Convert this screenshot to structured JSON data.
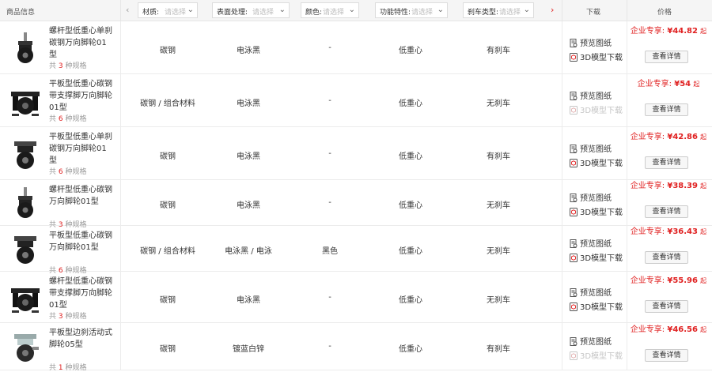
{
  "header": {
    "product_col": "商品信息",
    "prev_icon": "chevron-left-icon",
    "next_icon": "chevron-right-icon",
    "filters": [
      {
        "label": "材质:",
        "placeholder": "请选择"
      },
      {
        "label": "表面处理:",
        "placeholder": "请选择"
      },
      {
        "label": "颜色:",
        "placeholder": "请选择"
      },
      {
        "label": "功能特性:",
        "placeholder": "请选择"
      },
      {
        "label": "刹车类型:",
        "placeholder": "请选择"
      }
    ],
    "download_col": "下载",
    "price_col": "价格"
  },
  "labels": {
    "count_prefix": "共",
    "count_suffix": "种规格",
    "preview": "预览图纸",
    "model3d": "3D模型下载",
    "price_prefix": "企业专享:",
    "currency": "¥",
    "price_unit": "起",
    "detail_button": "查看详情"
  },
  "colors": {
    "accent": "#e02020",
    "disabled": "#c6c6c6"
  },
  "products": [
    {
      "name": "螺杆型低重心单刹碳钢万向脚轮01型",
      "count": "3",
      "image": "threaded-stem-caster",
      "material": "碳钢",
      "surface": "电泳黑",
      "color": "-",
      "feature": "低重心",
      "brake": "有刹车",
      "model_available": true,
      "price": "44.82"
    },
    {
      "name": "平板型低重心碳钢带支撑脚万向脚轮01型",
      "count": "6",
      "image": "plate-leveling-caster",
      "material": "碳钢 / 组合材料",
      "surface": "电泳黑",
      "color": "-",
      "feature": "低重心",
      "brake": "无刹车",
      "model_available": false,
      "price": "54"
    },
    {
      "name": "平板型低重心单刹碳钢万向脚轮01型",
      "count": "6",
      "image": "plate-brake-caster",
      "material": "碳钢",
      "surface": "电泳黑",
      "color": "-",
      "feature": "低重心",
      "brake": "有刹车",
      "model_available": true,
      "price": "42.86"
    },
    {
      "name": "螺杆型低重心碳钢万向脚轮01型",
      "count": "3",
      "image": "threaded-stem-caster",
      "material": "碳钢",
      "surface": "电泳黑",
      "color": "-",
      "feature": "低重心",
      "brake": "无刹车",
      "model_available": true,
      "price": "38.39"
    },
    {
      "name": "平板型低重心碳钢万向脚轮01型",
      "count": "6",
      "image": "plate-caster",
      "material": "碳钢 / 组合材料",
      "surface": "电泳黑 / 电泳",
      "color": "黑色",
      "feature": "低重心",
      "brake": "无刹车",
      "model_available": true,
      "price": "36.43"
    },
    {
      "name": "螺杆型低重心碳钢带支撑脚万向脚轮01型",
      "count": "3",
      "image": "threaded-leveling-caster",
      "material": "碳钢",
      "surface": "电泳黑",
      "color": "-",
      "feature": "低重心",
      "brake": "无刹车",
      "model_available": true,
      "price": "55.96"
    },
    {
      "name": "平板型边刹活动式脚轮05型",
      "count": "1",
      "image": "plate-side-brake-caster",
      "material": "碳钢",
      "surface": "镀蓝白锌",
      "color": "-",
      "feature": "低重心",
      "brake": "有刹车",
      "model_available": false,
      "price": "46.56"
    }
  ]
}
